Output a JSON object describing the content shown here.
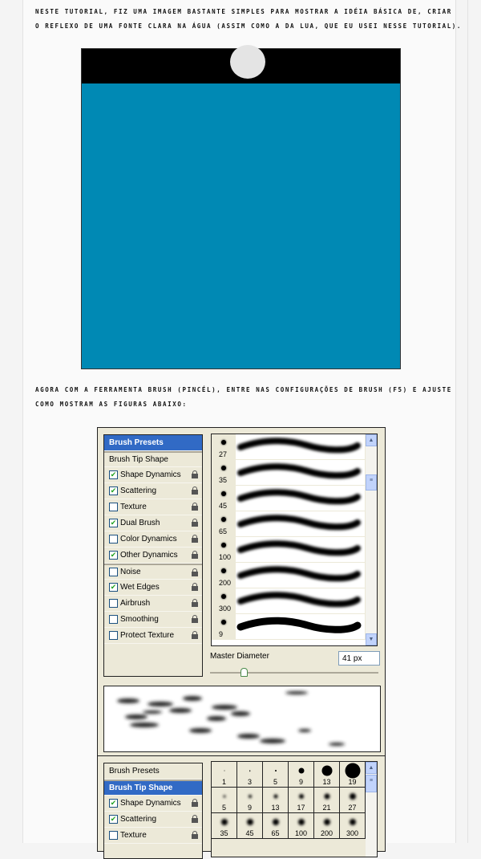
{
  "intro": {
    "line1": "Neste tutorial, fiz uma imagem bastante simples para mostrar a idéia básica de, criar",
    "line2": "o reflexo de uma fonte clara na água (assim como a da lua, que eu usei nesse tutorial)."
  },
  "instructions": {
    "line1": "Agora com a ferramenta Brush (Pincél), entre nas configurações de Brush (F5) e ajuste",
    "line2": "como mostram as figuras abaixo:"
  },
  "colors": {
    "water": "#0089b4",
    "sky": "#000000",
    "moon": "#e4e4e4",
    "selection": "#316ac5"
  },
  "panel1": {
    "items": [
      {
        "label": "Brush Presets",
        "selected": true
      },
      {
        "label": "Brush Tip Shape"
      },
      {
        "label": "Shape Dynamics",
        "checked": true
      },
      {
        "label": "Scattering",
        "checked": true
      },
      {
        "label": "Texture",
        "checked": false
      },
      {
        "label": "Dual Brush",
        "checked": true
      },
      {
        "label": "Color Dynamics",
        "checked": false
      },
      {
        "label": "Other Dynamics",
        "checked": true
      },
      {
        "label": "Noise",
        "checked": false
      },
      {
        "label": "Wet Edges",
        "checked": true
      },
      {
        "label": "Airbrush",
        "checked": false
      },
      {
        "label": "Smoothing",
        "checked": false
      },
      {
        "label": "Protect Texture",
        "checked": false
      }
    ],
    "presets": [
      "27",
      "35",
      "45",
      "65",
      "100",
      "200",
      "300",
      "9"
    ],
    "master_diameter_label": "Master Diameter",
    "master_diameter_value": "41 px",
    "slider_fraction": 0.2
  },
  "panel2": {
    "items": [
      {
        "label": "Brush Presets"
      },
      {
        "label": "Brush Tip Shape",
        "selected": true
      },
      {
        "label": "Shape Dynamics",
        "checked": true
      },
      {
        "label": "Scattering",
        "checked": true
      },
      {
        "label": "Texture",
        "checked": false
      }
    ],
    "tips": [
      "1",
      "3",
      "5",
      "9",
      "13",
      "19",
      "5",
      "9",
      "13",
      "17",
      "21",
      "27",
      "35",
      "45",
      "65",
      "100",
      "200",
      "300"
    ]
  }
}
